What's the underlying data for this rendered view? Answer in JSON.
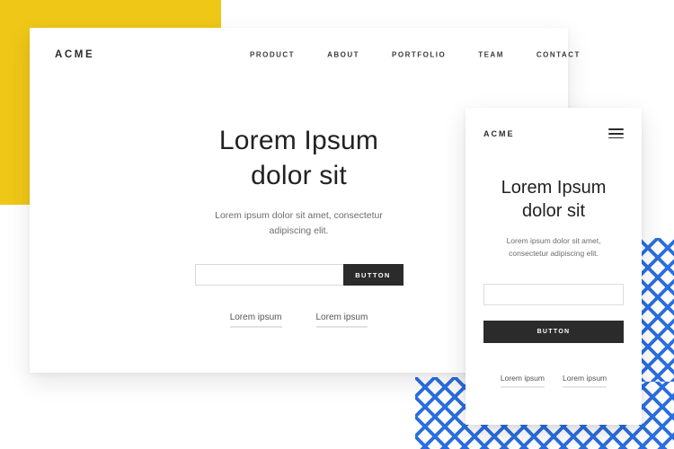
{
  "decor": {
    "yellow_block_color": "#EFC717",
    "dash_pattern_color": "#2B6FE0",
    "card_background": "#FFFFFF",
    "button_color": "#2B2B2B"
  },
  "desktop": {
    "brand": "ACME",
    "nav": [
      {
        "label": "PRODUCT"
      },
      {
        "label": "ABOUT"
      },
      {
        "label": "PORTFOLIO"
      },
      {
        "label": "TEAM"
      },
      {
        "label": "CONTACT"
      }
    ],
    "hero": {
      "title_line1": "Lorem Ipsum",
      "title_line2": "dolor sit",
      "subtitle_line1": "Lorem ipsum dolor sit amet, consectetur",
      "subtitle_line2": "adipiscing elit."
    },
    "form": {
      "input_value": "",
      "input_placeholder": "",
      "button_label": "BUTTON"
    },
    "footer_links": [
      {
        "label": "Lorem ipsum"
      },
      {
        "label": "Lorem ipsum"
      }
    ]
  },
  "mobile": {
    "brand": "ACME",
    "menu_icon": "hamburger-icon",
    "hero": {
      "title_line1": "Lorem Ipsum",
      "title_line2": "dolor sit",
      "subtitle_line1": "Lorem ipsum dolor sit amet,",
      "subtitle_line2": "consectetur adipiscing elit."
    },
    "form": {
      "input_value": "",
      "input_placeholder": "",
      "button_label": "BUTTON"
    },
    "footer_links": [
      {
        "label": "Lorem ipsum"
      },
      {
        "label": "Lorem ipsum"
      }
    ]
  }
}
